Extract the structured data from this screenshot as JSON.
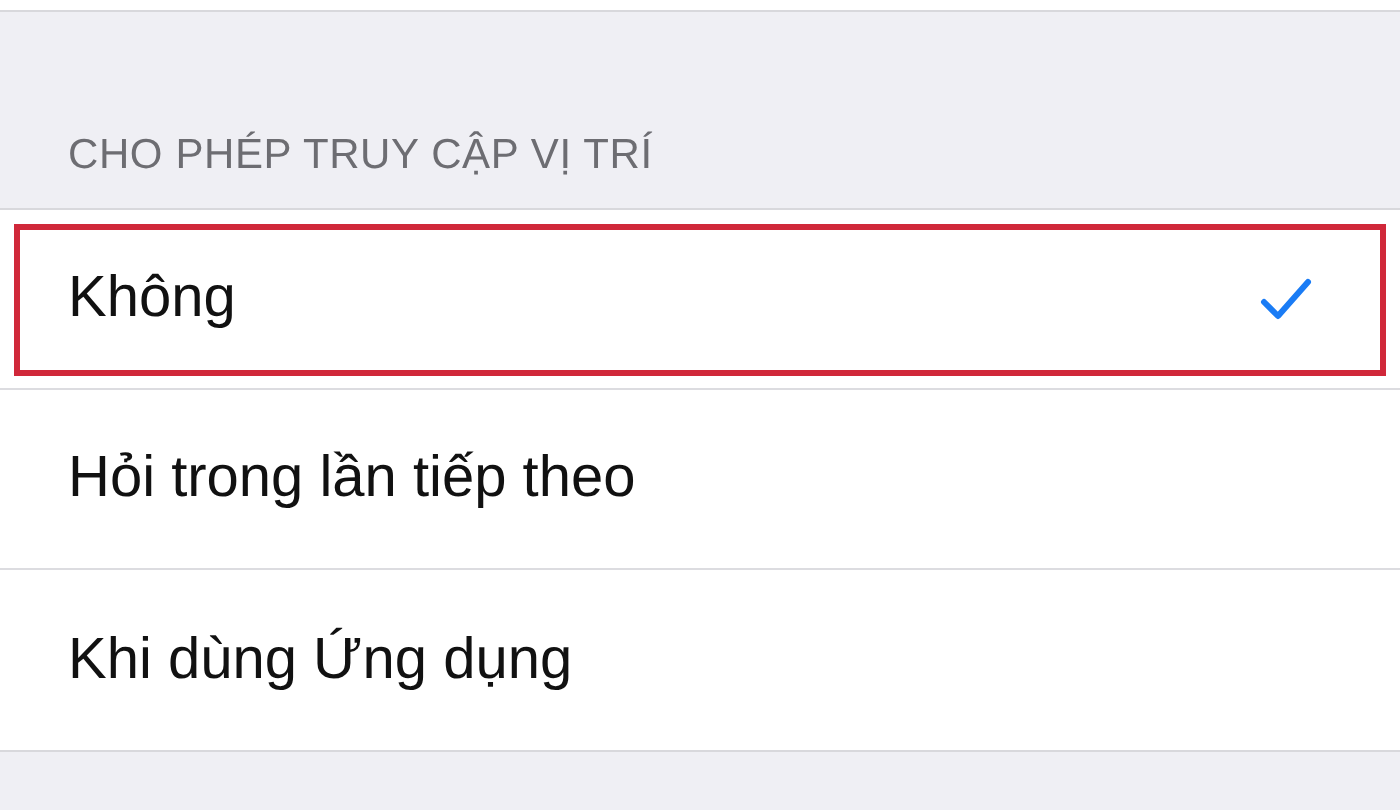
{
  "section": {
    "header": "CHO PHÉP TRUY CẬP VỊ TRÍ"
  },
  "options": [
    {
      "label": "Không",
      "selected": true,
      "highlighted": true
    },
    {
      "label": "Hỏi trong lần tiếp theo",
      "selected": false,
      "highlighted": false
    },
    {
      "label": "Khi dùng Ứng dụng",
      "selected": false,
      "highlighted": false
    }
  ]
}
